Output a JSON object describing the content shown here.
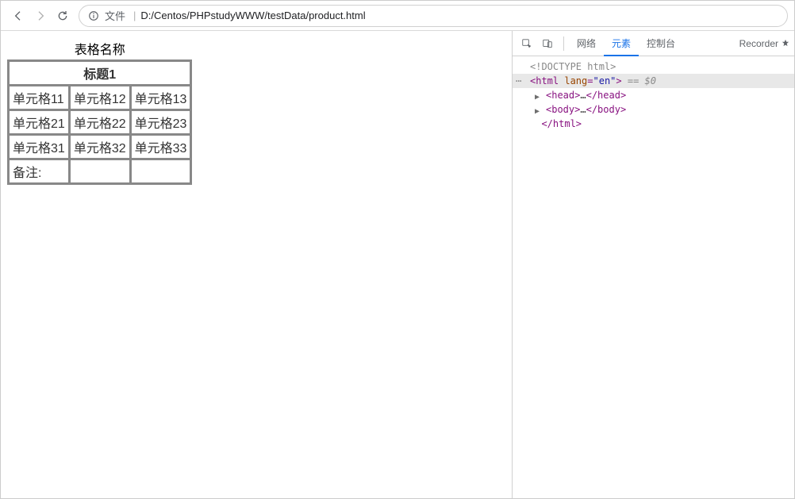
{
  "browser": {
    "file_label": "文件",
    "url_path": "D:/Centos/PHPstudyWWW/testData/product.html"
  },
  "page": {
    "table_caption": "表格名称",
    "table_header": "标题1",
    "rows": [
      [
        "单元格11",
        "单元格12",
        "单元格13"
      ],
      [
        "单元格21",
        "单元格22",
        "单元格23"
      ],
      [
        "单元格31",
        "单元格32",
        "单元格33"
      ]
    ],
    "footer_label": "备注:"
  },
  "devtools": {
    "tabs": {
      "network": "网络",
      "elements": "元素",
      "console": "控制台",
      "recorder": "Recorder"
    },
    "dom": {
      "doctype": "<!DOCTYPE html>",
      "html_open_pre": "<html ",
      "html_lang_attr": "lang",
      "html_lang_val": "\"en\"",
      "html_open_post": ">",
      "eq_sel": " == $0",
      "head_open": "<head>",
      "ellipsis": "…",
      "head_close": "</head>",
      "body_open": "<body>",
      "body_close": "</body>",
      "html_close": "</html>"
    }
  }
}
